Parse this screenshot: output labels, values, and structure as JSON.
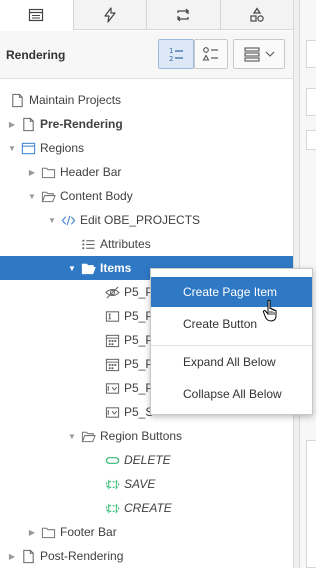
{
  "tabs": [
    {
      "icon": "rendering-tree-icon",
      "active": true
    },
    {
      "icon": "lightning-icon",
      "active": false
    },
    {
      "icon": "processing-icon",
      "active": false
    },
    {
      "icon": "shared-components-icon",
      "active": false
    }
  ],
  "header": {
    "title": "Rendering"
  },
  "tree": {
    "root": "Maintain Projects",
    "pre_rendering": "Pre-Rendering",
    "regions": "Regions",
    "header_bar": "Header Bar",
    "content_body": "Content Body",
    "edit_region": "Edit OBE_PROJECTS",
    "attributes": "Attributes",
    "items": "Items",
    "item_rows": [
      "P5_P",
      "P5_P",
      "P5_P",
      "P5_P",
      "P5_P",
      "P5_S"
    ],
    "region_buttons": "Region Buttons",
    "buttons": [
      "DELETE",
      "SAVE",
      "CREATE"
    ],
    "footer_bar": "Footer Bar",
    "post_rendering": "Post-Rendering"
  },
  "context_menu": {
    "items": [
      "Create Page Item",
      "Create Button",
      "Expand All Below",
      "Collapse All Below"
    ],
    "highlighted": "Create Page Item"
  },
  "colors": {
    "selection": "#2f78c4",
    "button_icon": "#2eb872",
    "folder": "#777777"
  }
}
